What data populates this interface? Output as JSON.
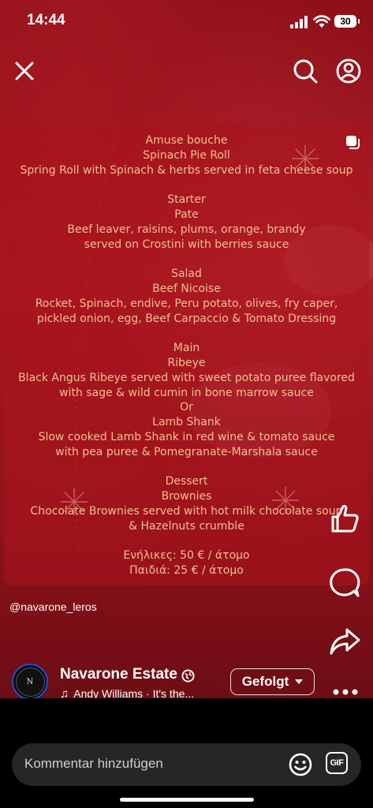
{
  "status_bar": {
    "time": "14:44",
    "battery": "30"
  },
  "top_bar": {
    "close_icon": "close-icon",
    "search_icon": "search-icon",
    "profile_icon": "profile-icon"
  },
  "post": {
    "menu_lines": {
      "amuse_title": "Amuse bouche",
      "amuse_1": "Spinach Pie Roll",
      "amuse_2": "Spring Roll with Spinach & herbs served in feta cheese soup",
      "starter_title": "Starter",
      "starter_1": "Pate",
      "starter_2": "Beef leaver, raisins, plums, orange, brandy",
      "starter_3": "served on Crostini with berries sauce",
      "salad_title": "Salad",
      "salad_1": "Beef Nicoise",
      "salad_2": "Rocket, Spinach, endive, Peru potato, olives, fry caper,",
      "salad_3": "pickled onion, egg, Beef Carpaccio & Tomato Dressing",
      "main_title": "Main",
      "main_1": "Ribeye",
      "main_2": "Black Angus Ribeye served with sweet potato puree flavored",
      "main_3": "with sage & wild cumin in bone marrow sauce",
      "main_or": "Or",
      "main_4": "Lamb Shank",
      "main_5": "Slow cooked Lamb Shank in red wine & tomato sauce",
      "main_6": "with pea puree & Pomegranate-Marshala sauce",
      "dessert_title": "Dessert",
      "dessert_1": "Brownies",
      "dessert_2": "Chocolate Brownies served with hot milk chocolate soup",
      "dessert_3": "& Hazelnuts crumble",
      "price_adults": "Ενήλικες: 50 € / άτομο",
      "price_kids": "Παιδιά: 25 € / άτομο"
    },
    "tagged_handle": "@navarone_leros"
  },
  "account": {
    "name": "Navarone Estate",
    "avatar_text": "NAVARONE",
    "follow_label": "Gefolgt",
    "music": "Andy Williams · It's the..."
  },
  "comment": {
    "placeholder": "Kommentar hinzufügen",
    "gif_label": "GIF"
  },
  "colors": {
    "accent_blue": "#1c4fd6",
    "menu_text": "#f1c08f",
    "background_red": "#a0141d"
  }
}
